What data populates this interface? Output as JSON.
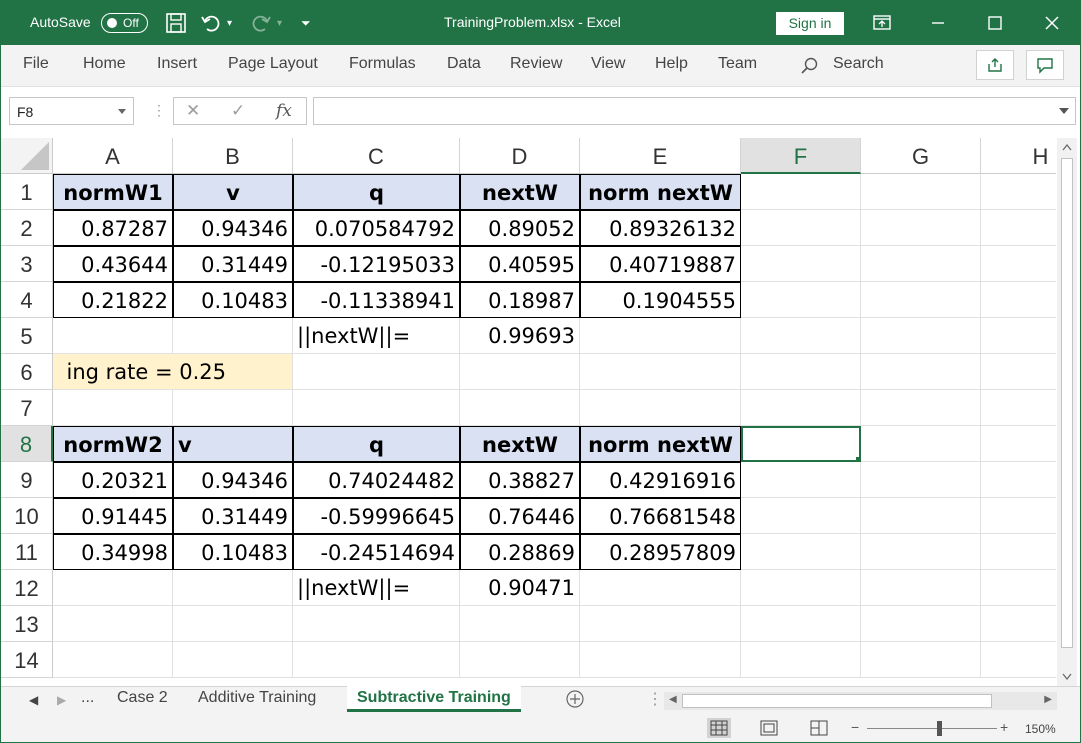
{
  "titlebar": {
    "autosave_label": "AutoSave",
    "autosave_state": "Off",
    "doc_title": "TrainingProblem.xlsx  -  Excel",
    "signin_label": "Sign in"
  },
  "ribbon": {
    "tabs": [
      "File",
      "Home",
      "Insert",
      "Page Layout",
      "Formulas",
      "Data",
      "Review",
      "View",
      "Help",
      "Team"
    ],
    "search_label": "Search"
  },
  "formula_bar": {
    "name_box": "F8",
    "fx_label": "fx",
    "formula": ""
  },
  "columns": [
    "A",
    "B",
    "C",
    "D",
    "E",
    "F",
    "G",
    "H"
  ],
  "rows": [
    "1",
    "2",
    "3",
    "4",
    "5",
    "6",
    "7",
    "8",
    "9",
    "10",
    "11",
    "12",
    "13",
    "14"
  ],
  "cells": {
    "A1": "normW1",
    "B1": "v",
    "C1": "q",
    "D1": "nextW",
    "E1": "norm nextW",
    "A2": "0.87287",
    "B2": "0.94346",
    "C2": "0.070584792",
    "D2": "0.89052",
    "E2": "0.89326132",
    "A3": "0.43644",
    "B3": "0.31449",
    "C3": "-0.12195033",
    "D3": "0.40595",
    "E3": "0.40719887",
    "A4": "0.21822",
    "B4": "0.10483",
    "C4": "-0.11338941",
    "D4": "0.18987",
    "E4": "0.1904555",
    "C5": "||nextW||=",
    "D5": "0.99693",
    "A6": "ing rate =  0.25",
    "A8": "normW2",
    "B8": "v",
    "C8": "q",
    "D8": "nextW",
    "E8": "norm nextW",
    "A9": "0.20321",
    "B9": "0.94346",
    "C9": "0.74024482",
    "D9": "0.38827",
    "E9": "0.42916916",
    "A10": "0.91445",
    "B10": "0.31449",
    "C10": "-0.59996645",
    "D10": "0.76446",
    "E10": "0.76681548",
    "A11": "0.34998",
    "B11": "0.10483",
    "C11": "-0.24514694",
    "D11": "0.28869",
    "E11": "0.28957809",
    "C12": "||nextW||=",
    "D12": "0.90471"
  },
  "sheet_tabs": {
    "ellipsis": "...",
    "tabs": [
      "Case 2",
      "Additive Training",
      "Subtractive Training"
    ],
    "active": "Subtractive Training"
  },
  "status": {
    "zoom": "150%"
  },
  "colors": {
    "accent": "#217346",
    "header_fill": "#d9e1f2",
    "rate_fill": "#fff2cc"
  }
}
